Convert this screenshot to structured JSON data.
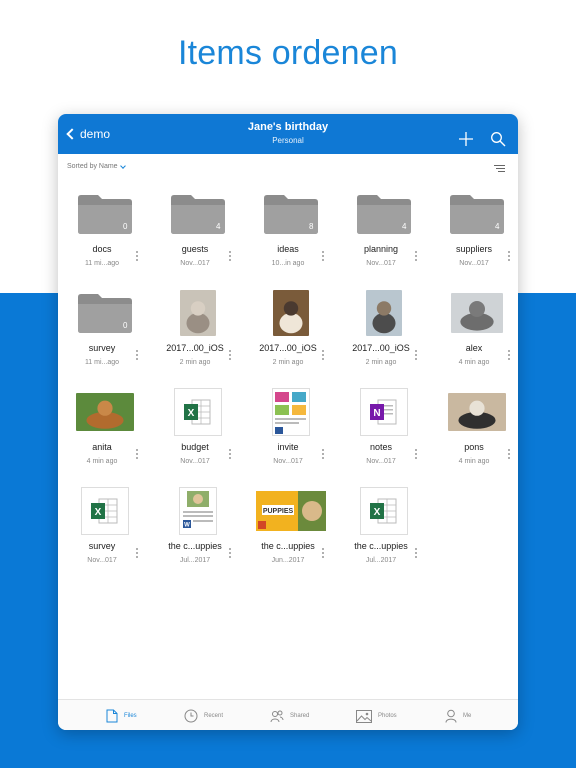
{
  "promo": {
    "title": "Items ordenen"
  },
  "navbar": {
    "back_label": "demo",
    "title": "Jane's birthday",
    "subtitle": "Personal"
  },
  "sortbar": {
    "label": "Sorted by Name"
  },
  "colors": {
    "accent": "#0f78d4",
    "background_bottom": "#0a79d6",
    "folder": "#8c8c8c"
  },
  "items": [
    {
      "name": "docs",
      "meta": "11 mi...ago",
      "kind": "folder",
      "count": "0"
    },
    {
      "name": "guests",
      "meta": "Nov...017",
      "kind": "folder",
      "count": "4"
    },
    {
      "name": "ideas",
      "meta": "10...in ago",
      "kind": "folder",
      "count": "8"
    },
    {
      "name": "planning",
      "meta": "Nov...017",
      "kind": "folder",
      "count": "4"
    },
    {
      "name": "suppliers",
      "meta": "Nov...017",
      "kind": "folder",
      "count": "4"
    },
    {
      "name": "survey",
      "meta": "11 mi...ago",
      "kind": "folder",
      "count": "0"
    },
    {
      "name": "2017...00_iOS",
      "meta": "2 min ago",
      "kind": "photo",
      "subject": "cat"
    },
    {
      "name": "2017...00_iOS",
      "meta": "2 min ago",
      "kind": "photo",
      "subject": "siamese-cat"
    },
    {
      "name": "2017...00_iOS",
      "meta": "2 min ago",
      "kind": "photo",
      "subject": "statue"
    },
    {
      "name": "alex",
      "meta": "4 min ago",
      "kind": "photo",
      "subject": "dog"
    },
    {
      "name": "anita",
      "meta": "4 min ago",
      "kind": "photo",
      "subject": "boxer-dog"
    },
    {
      "name": "budget",
      "meta": "Nov...017",
      "kind": "excel"
    },
    {
      "name": "invite",
      "meta": "Nov...017",
      "kind": "invite"
    },
    {
      "name": "notes",
      "meta": "Nov...017",
      "kind": "onenote"
    },
    {
      "name": "pons",
      "meta": "4 min ago",
      "kind": "photo",
      "subject": "beach-dog"
    },
    {
      "name": "survey",
      "meta": "Nov...017",
      "kind": "excel"
    },
    {
      "name": "the c...uppies",
      "meta": "Jul...2017",
      "kind": "word"
    },
    {
      "name": "the c...uppies",
      "meta": "Jun...2017",
      "kind": "powerpoint",
      "banner": "PUPPIES"
    },
    {
      "name": "the c...uppies",
      "meta": "Jul...2017",
      "kind": "excel"
    }
  ],
  "tabbar": {
    "files": "Files",
    "recent": "Recent",
    "shared": "Shared",
    "photos": "Photos",
    "me": "Me"
  }
}
